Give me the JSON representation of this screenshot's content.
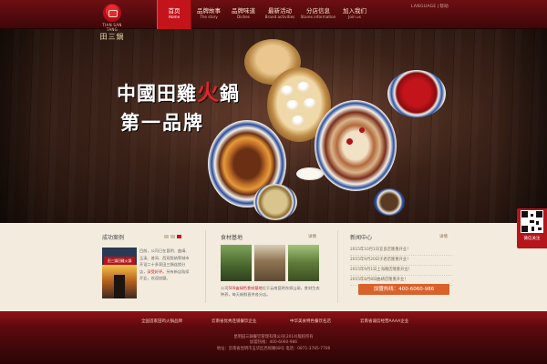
{
  "logo": {
    "en": "TIAN SAN TANG",
    "cn": "田三鍋"
  },
  "nav": [
    {
      "zh": "首页",
      "en": "Home"
    },
    {
      "zh": "品牌故事",
      "en": "The story"
    },
    {
      "zh": "品牌味道",
      "en": "Dishes"
    },
    {
      "zh": "最新活动",
      "en": "Brand activities"
    },
    {
      "zh": "分店信息",
      "en": "Stores information"
    },
    {
      "zh": "加入我们",
      "en": "Join us"
    }
  ],
  "lang": {
    "language": "LANGUAGE",
    "help": "帮助"
  },
  "banner": {
    "slogan_part1": "中國田雞",
    "slogan_hot": "火",
    "slogan_part2": "鍋",
    "slogan_line2": "第一品牌"
  },
  "qr": {
    "label": "微信关注"
  },
  "sections": {
    "cases": {
      "title": "成功案例",
      "sign": "田三鍋田雞火鍋",
      "text_lead": "目前，公司已在昆明、曲靖、玉溪、普洱、西双版纳等城市开设二十多家田三鍋连锁分店，",
      "text_highlight": "深受好评。",
      "text_tail": "另有新店陆续开业，欢迎加盟。"
    },
    "base": {
      "title": "食材基地",
      "more": "详情",
      "text_lead": "公司",
      "text_highlight": "500亩绿色食材基地",
      "text_tail": "位于云南昆明东郊山坳，食材生态种养，每天新鲜直供各分店。"
    },
    "news": {
      "title": "新闻中心",
      "more": "详情",
      "items": [
        "2015年10月1日宜良店隆重开业！",
        "2015年9月20日子君店隆重开业！",
        "2015年9月1日上海路店隆重开业！",
        "2015年8月8日曲靖店隆重开业！"
      ],
      "hotline": "加盟热线：400-6060-986"
    }
  },
  "footer": {
    "partners": [
      "全国首家田鸡火锅品牌",
      "云南省优秀连锁餐饮企业",
      "中华美食特色餐饮名店",
      "云南省诚信经营AAAA企业"
    ],
    "lines": [
      "昆明田三鍋餐饮管理有限公司(2014)版权所有",
      "加盟热线：400-6060-986",
      "地址：云南省昆明市五华区西坝路68号 电话：0871-3785-7706"
    ]
  }
}
